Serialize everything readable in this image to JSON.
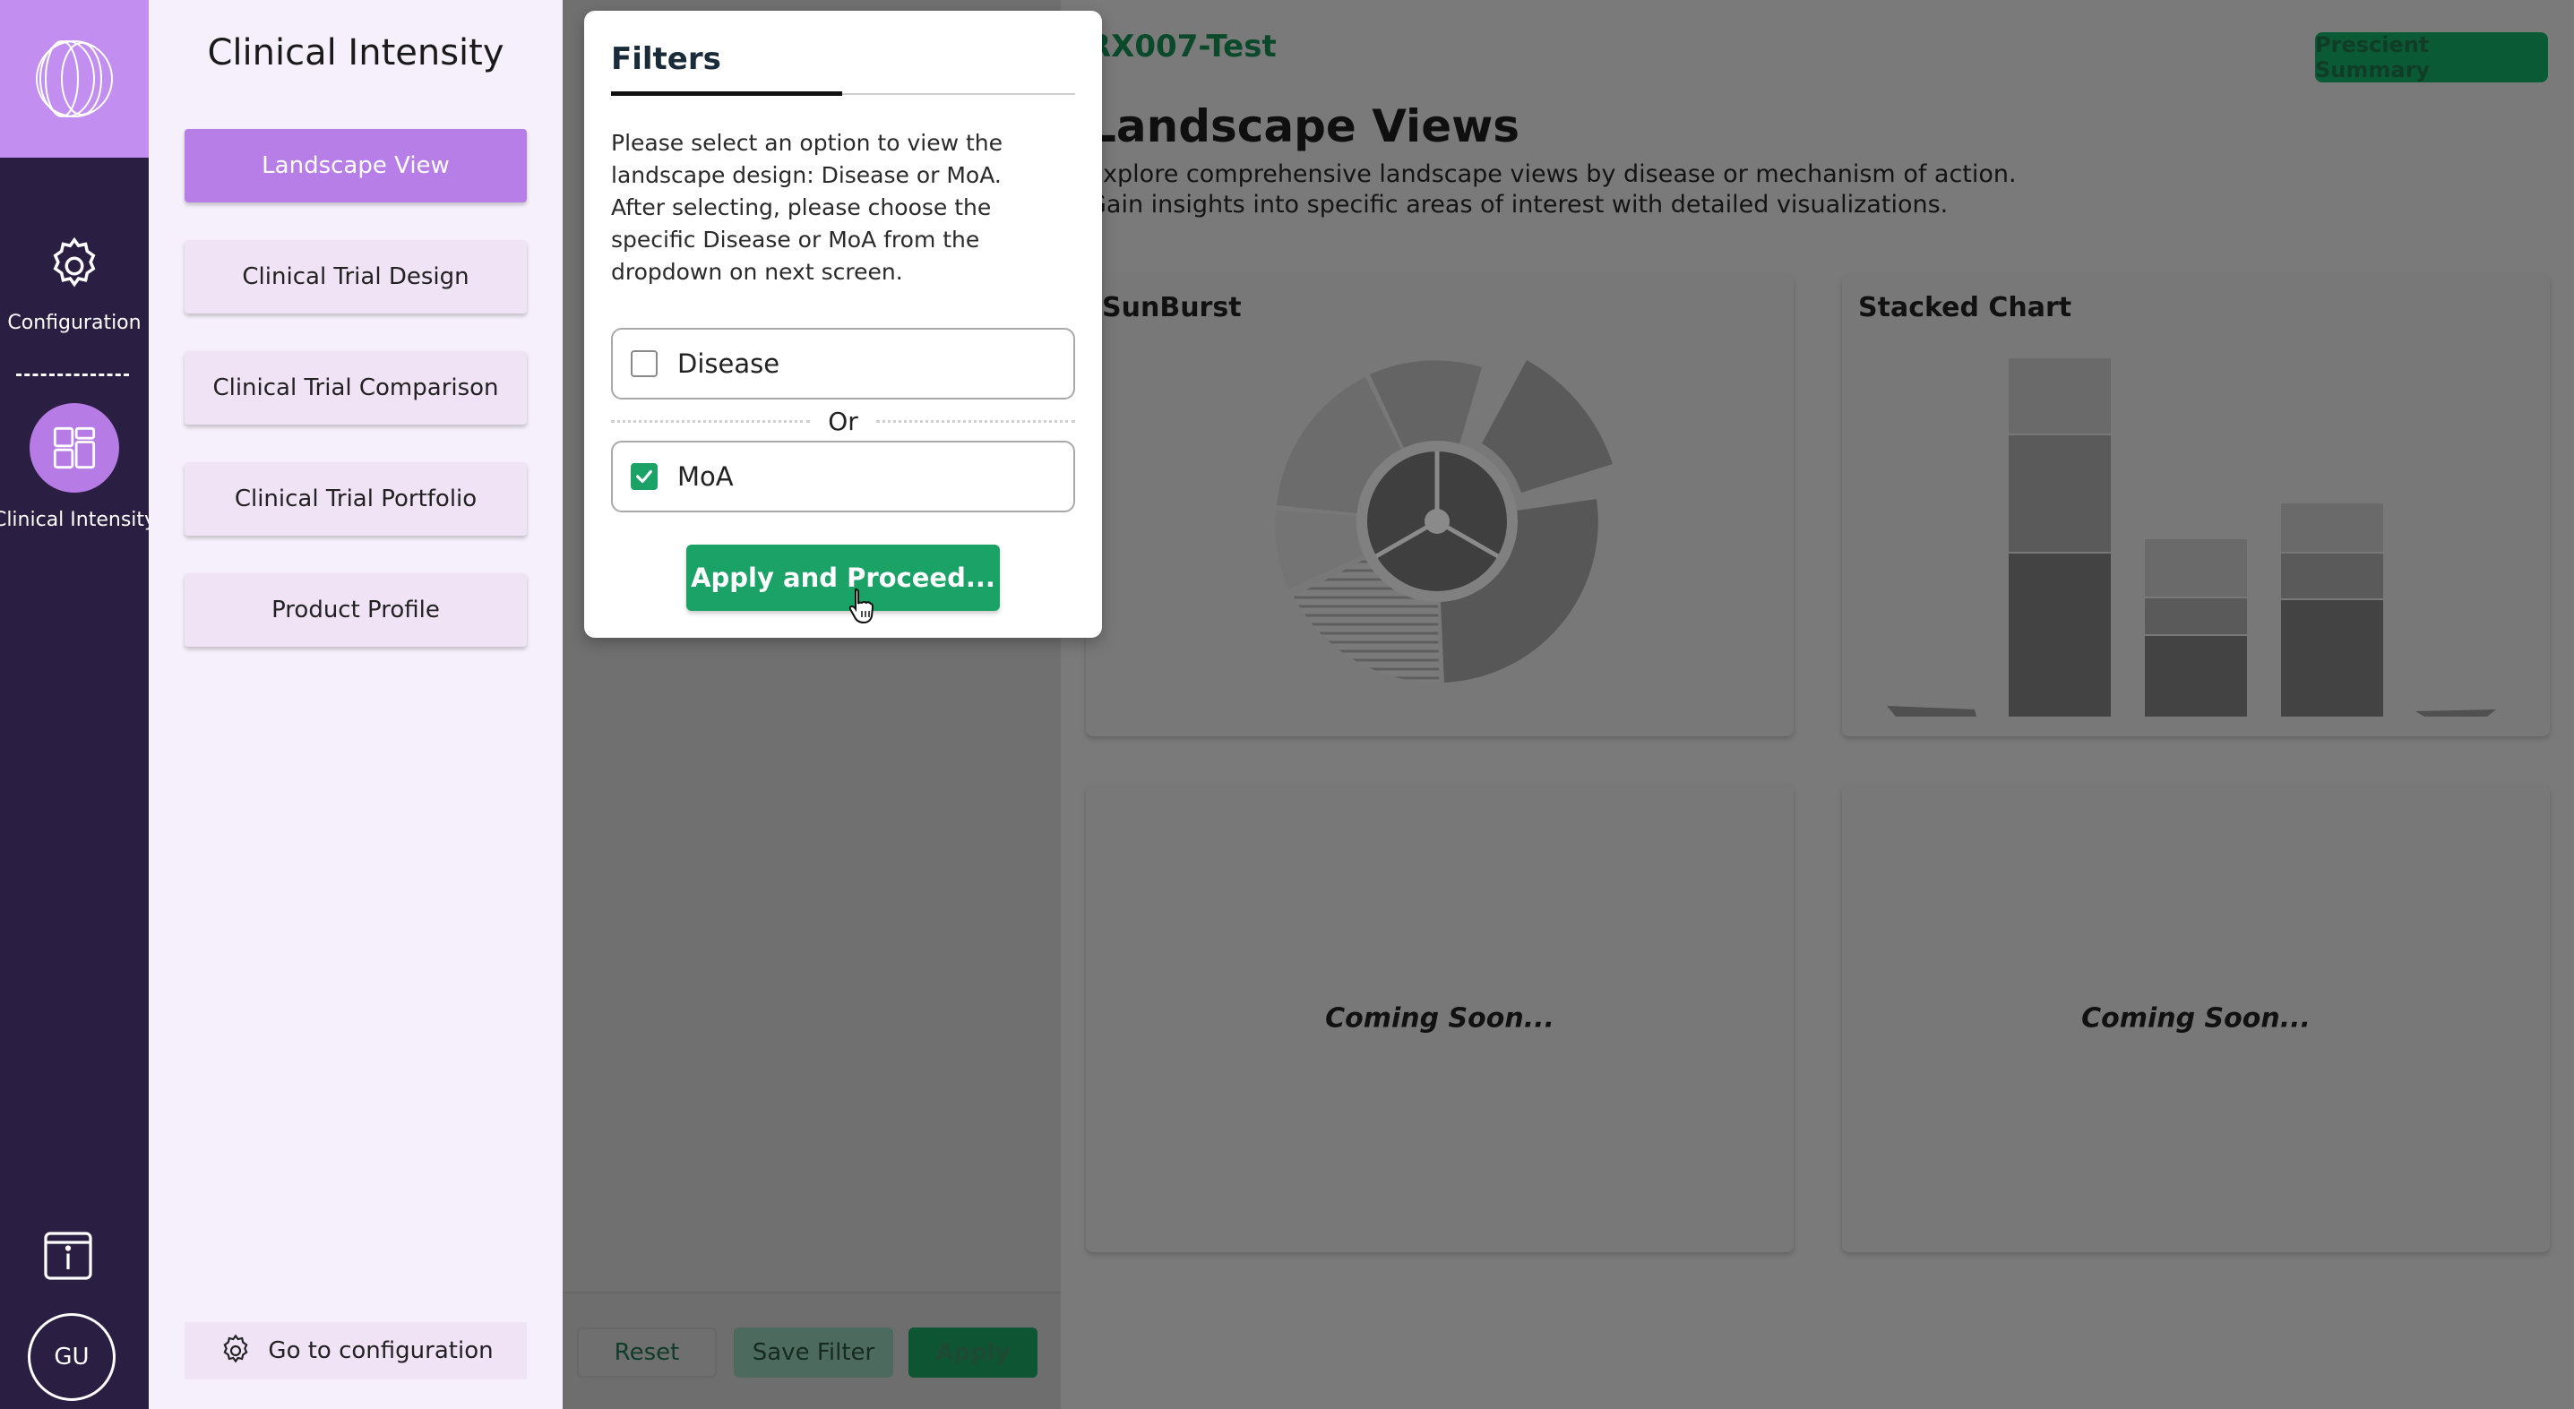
{
  "rail": {
    "configuration_label": "Configuration",
    "clinical_intensity_label": "Clinical Intensity",
    "user_initials": "GU",
    "accent": "#c28ef0",
    "background": "#2a1e42"
  },
  "nav": {
    "title": "Clinical Intensity",
    "items": [
      {
        "label": "Landscape View",
        "active": true
      },
      {
        "label": "Clinical Trial Design",
        "active": false
      },
      {
        "label": "Clinical Trial Comparison",
        "active": false
      },
      {
        "label": "Clinical Trial Portfolio",
        "active": false
      },
      {
        "label": "Product Profile",
        "active": false
      }
    ],
    "config_link": "Go to configuration"
  },
  "main": {
    "project_title": "RX007-Test",
    "summary_button": "Prescient Summary",
    "heading": "Landscape Views",
    "description": "Explore comprehensive landscape views by disease or mechanism of action. Gain insights into specific areas of interest with detailed visualizations.",
    "cards": [
      {
        "title": "SunBurst"
      },
      {
        "title": "Stacked Chart"
      },
      {
        "title": "",
        "placeholder": "Coming Soon..."
      },
      {
        "title": "",
        "placeholder": "Coming Soon..."
      }
    ]
  },
  "filter_panel": {
    "reset": "Reset",
    "save": "Save Filter",
    "apply": "Apply"
  },
  "modal": {
    "title": "Filters",
    "instructions": "Please select an option to view the landscape design: Disease or MoA.\nAfter selecting, please choose the specific Disease or MoA from the dropdown on next screen.",
    "option_disease": "Disease",
    "disease_checked": false,
    "separator": "Or",
    "option_moa": "MoA",
    "moa_checked": true,
    "proceed_button": "Apply and Proceed...",
    "accent": "#1aa267"
  }
}
